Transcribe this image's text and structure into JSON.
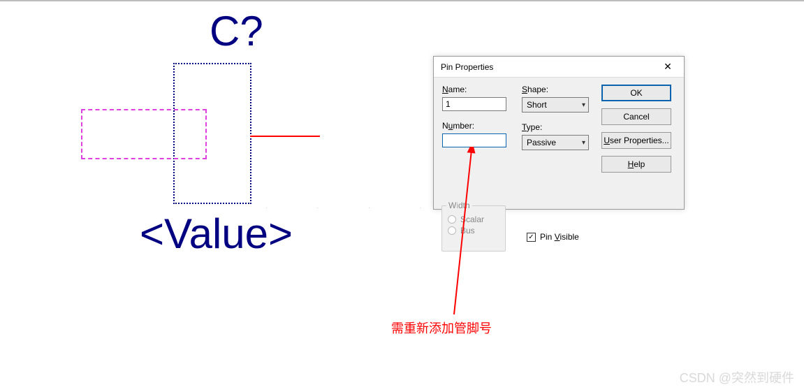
{
  "schematic": {
    "ref_label": "C?",
    "value_label": "<Value>"
  },
  "dialog": {
    "title": "Pin Properties",
    "name_label": "Name:",
    "name_value": "1",
    "number_label": "Number:",
    "number_value": "",
    "shape_label": "Shape:",
    "shape_value": "Short",
    "type_label": "Type:",
    "type_value": "Passive",
    "width_group": "Width",
    "width_scalar": "Scalar",
    "width_bus": "Bus",
    "pin_visible_label": "Pin Visible",
    "pin_visible_checked": "✓",
    "buttons": {
      "ok": "OK",
      "cancel": "Cancel",
      "user_props": "User Properties...",
      "help": "Help"
    }
  },
  "annotation": "需重新添加管脚号",
  "watermark": "CSDN @突然到硬件"
}
